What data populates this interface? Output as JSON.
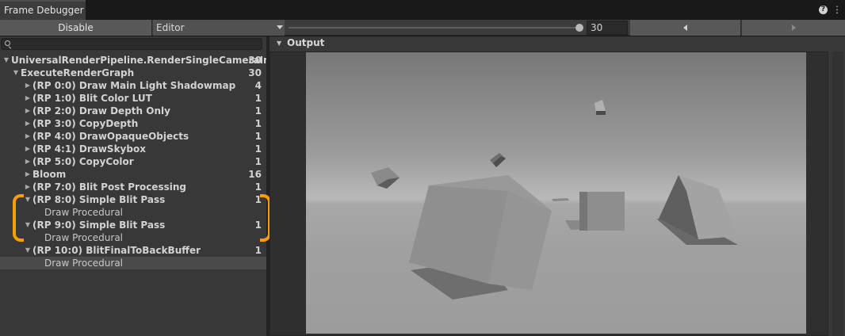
{
  "window": {
    "tab_title": "Frame Debugger"
  },
  "toolbar": {
    "disable_label": "Disable",
    "target_label": "Editor",
    "frame_value": "30"
  },
  "tree": {
    "rows": [
      {
        "label": "UniversalRenderPipeline.RenderSingleCameraInter",
        "count": "30",
        "depth": 0,
        "expanded": true
      },
      {
        "label": "ExecuteRenderGraph",
        "count": "30",
        "depth": 1,
        "expanded": true
      },
      {
        "label": "(RP 0:0) Draw Main Light Shadowmap",
        "count": "4",
        "depth": 2,
        "expanded": false
      },
      {
        "label": "(RP 1:0) Blit Color LUT",
        "count": "1",
        "depth": 2,
        "expanded": false
      },
      {
        "label": "(RP 2:0) Draw Depth Only",
        "count": "1",
        "depth": 2,
        "expanded": false
      },
      {
        "label": "(RP 3:0) CopyDepth",
        "count": "1",
        "depth": 2,
        "expanded": false
      },
      {
        "label": "(RP 4:0) DrawOpaqueObjects",
        "count": "1",
        "depth": 2,
        "expanded": false
      },
      {
        "label": "(RP 4:1) DrawSkybox",
        "count": "1",
        "depth": 2,
        "expanded": false
      },
      {
        "label": "(RP 5:0) CopyColor",
        "count": "1",
        "depth": 2,
        "expanded": false
      },
      {
        "label": "Bloom",
        "count": "16",
        "depth": 2,
        "expanded": false
      },
      {
        "label": "(RP 7:0) Blit Post Processing",
        "count": "1",
        "depth": 2,
        "expanded": false
      },
      {
        "label": "(RP 8:0) Simple Blit Pass",
        "count": "1",
        "depth": 2,
        "expanded": true
      },
      {
        "label": "Draw Procedural",
        "count": "",
        "depth": 3,
        "leaf": true
      },
      {
        "label": "(RP 9:0) Simple Blit Pass",
        "count": "1",
        "depth": 2,
        "expanded": true
      },
      {
        "label": "Draw Procedural",
        "count": "",
        "depth": 3,
        "leaf": true
      },
      {
        "label": "(RP 10:0) BlitFinalToBackBuffer",
        "count": "1",
        "depth": 2,
        "expanded": true
      },
      {
        "label": "Draw Procedural",
        "count": "",
        "depth": 3,
        "leaf": true,
        "selected": true
      }
    ]
  },
  "output": {
    "title": "Output"
  },
  "colors": {
    "annotation": "#f5a000",
    "selection": "#4a4a4a"
  },
  "icons": {
    "help": "help-icon",
    "menu": "kebab-menu-icon",
    "search": "search-icon"
  }
}
